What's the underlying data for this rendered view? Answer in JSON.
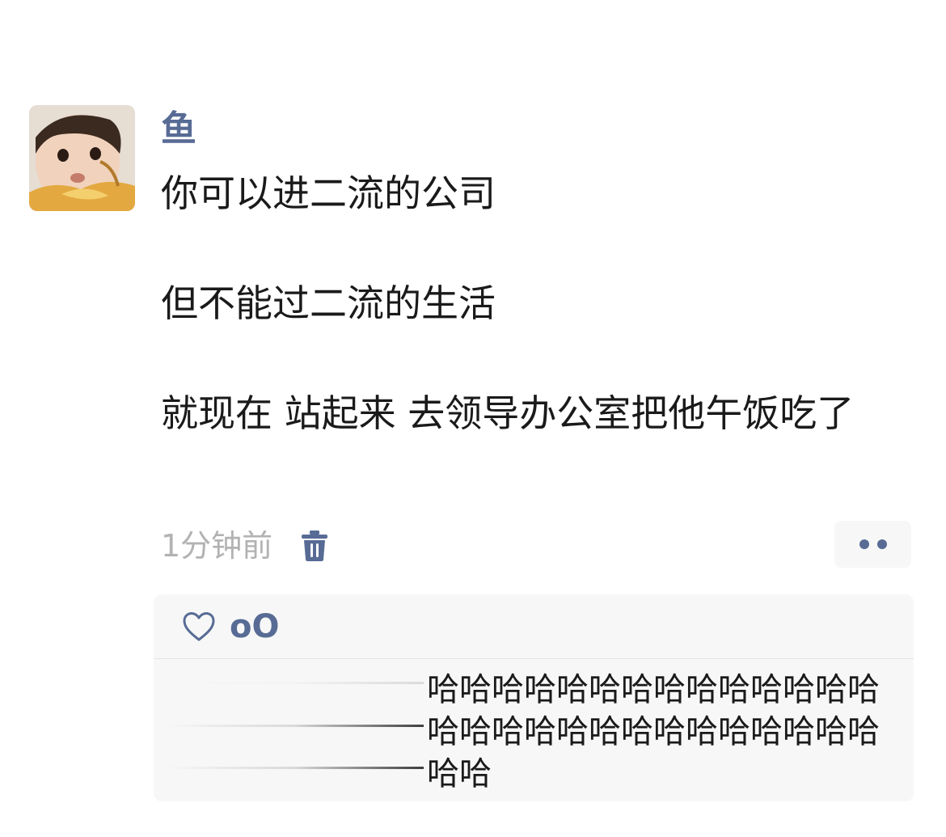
{
  "post": {
    "author": "鱼",
    "lines": [
      "你可以进二流的公司",
      "但不能过二流的生活",
      "就现在 站起来 去领导办公室把他午饭吃了"
    ],
    "time": "1分钟前",
    "delete_icon": "trash-icon",
    "more_icon": "more-dots-icon",
    "accent_color": "#576b95"
  },
  "interactions": {
    "like_icon": "heart-outline-icon",
    "likers": "oO",
    "comments": [
      {
        "text": "哈哈哈哈哈哈哈哈哈哈哈哈哈哈哈哈哈哈哈哈哈哈哈哈哈哈哈哈哈哈"
      }
    ]
  }
}
